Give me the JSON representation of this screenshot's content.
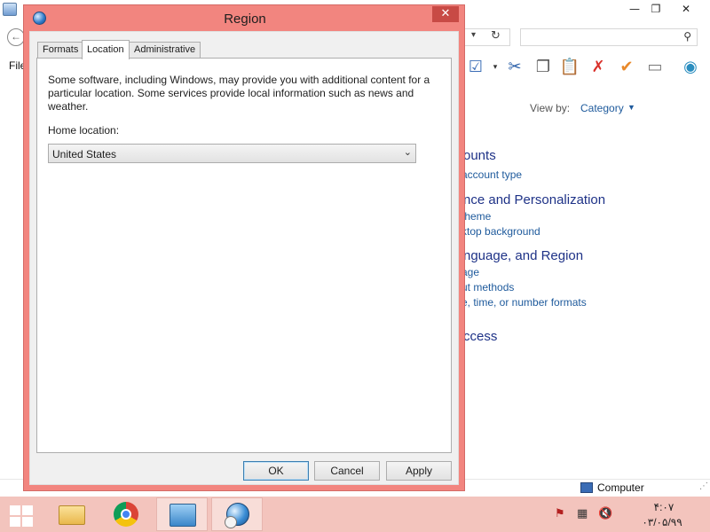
{
  "background_window": {
    "menu_file": "File",
    "view_by_label": "View by:",
    "view_by_value": "Category",
    "sections": [
      {
        "heading": "ounts",
        "links": [
          "account type"
        ]
      },
      {
        "heading": "nce and Personalization",
        "links": [
          "theme",
          "ktop background"
        ]
      },
      {
        "heading": "nguage, and Region",
        "links": [
          "age",
          "ut methods",
          "e, time, or number formats"
        ]
      },
      {
        "heading": "ccess",
        "links": []
      }
    ],
    "status_text": "Computer"
  },
  "dialog": {
    "title": "Region",
    "tabs": [
      {
        "label": "Formats",
        "active": false
      },
      {
        "label": "Location",
        "active": true
      },
      {
        "label": "Administrative",
        "active": false
      }
    ],
    "description": "Some software, including Windows, may provide you with additional content for a particular location. Some services provide local information such as news and weather.",
    "home_location_label": "Home location:",
    "home_location_value": "United States",
    "buttons": {
      "ok": "OK",
      "cancel": "Cancel",
      "apply": "Apply"
    }
  },
  "taskbar": {
    "clock_time": "۴:۰۷",
    "clock_date": "۰۳/۰۵/۹۹"
  },
  "colors": {
    "dialog_frame": "#f2857f",
    "taskbar": "#f3c4bd",
    "link": "#1e5a9c",
    "heading": "#1e3287"
  },
  "icons": [
    "control-panel-icon",
    "back-arrow-icon",
    "refresh-icon",
    "search-icon",
    "region-globe-icon",
    "close-icon",
    "dropdown-arrow-icon",
    "windows-start-icon",
    "file-explorer-icon",
    "chrome-icon",
    "globe-clock-icon",
    "flag-icon",
    "network-icon",
    "speaker-muted-icon"
  ]
}
